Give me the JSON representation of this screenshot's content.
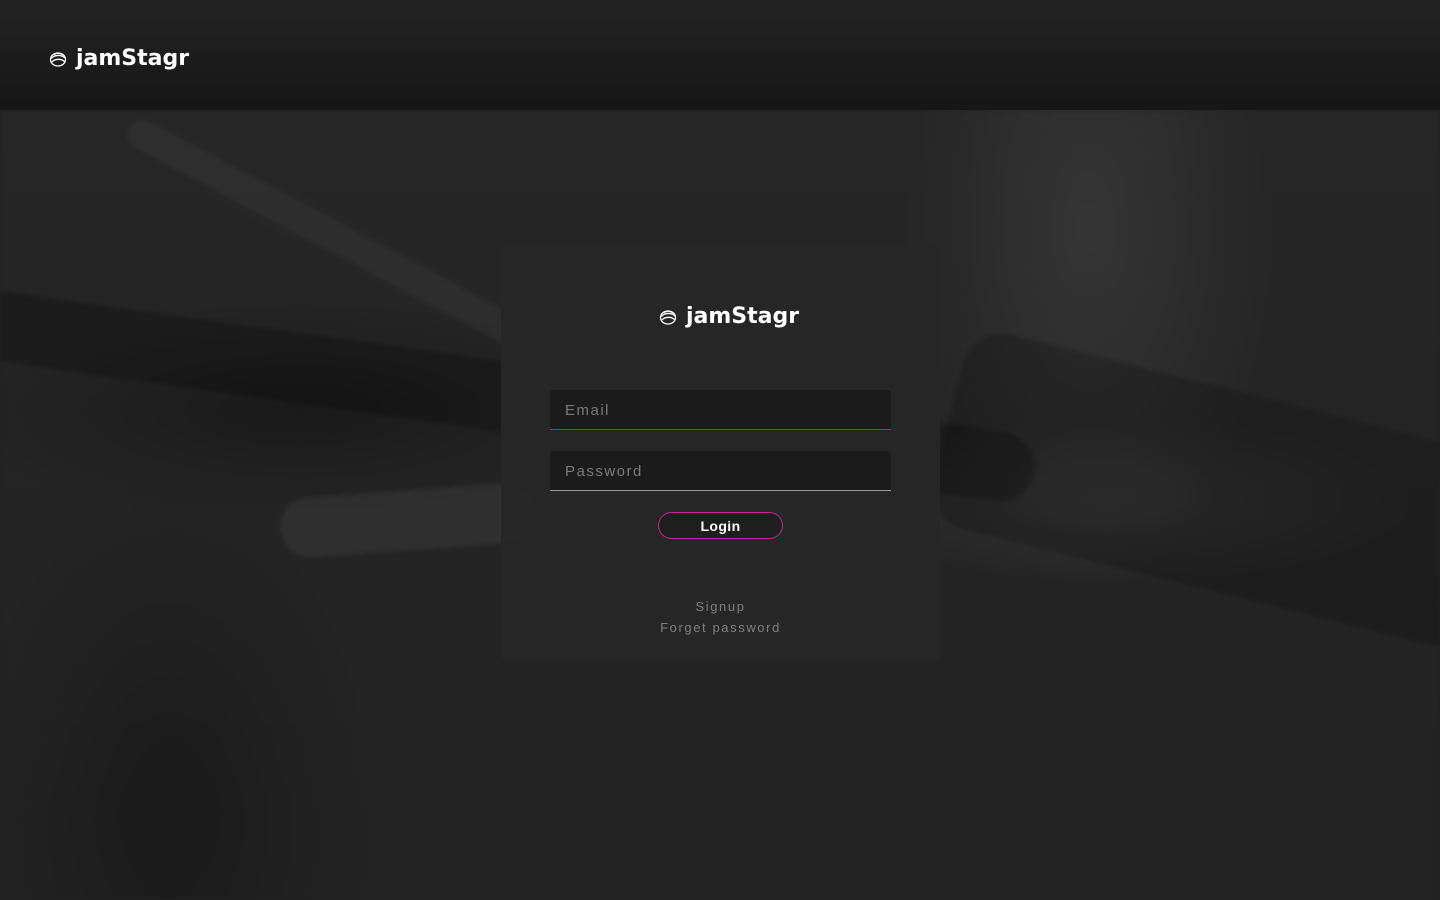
{
  "brand": {
    "name": "jamStagr",
    "logo_icon": "swirl-logo-icon"
  },
  "login_form": {
    "email_placeholder": "Email",
    "email_value": "",
    "password_placeholder": "Password",
    "password_value": "",
    "login_label": "Login",
    "signup_label": "Signup",
    "forget_password_label": "Forget password"
  },
  "colors": {
    "accent": "#c2268f",
    "background": "#222222",
    "card": "#262626",
    "input": "#1b1b1b",
    "muted_text": "#808080"
  }
}
